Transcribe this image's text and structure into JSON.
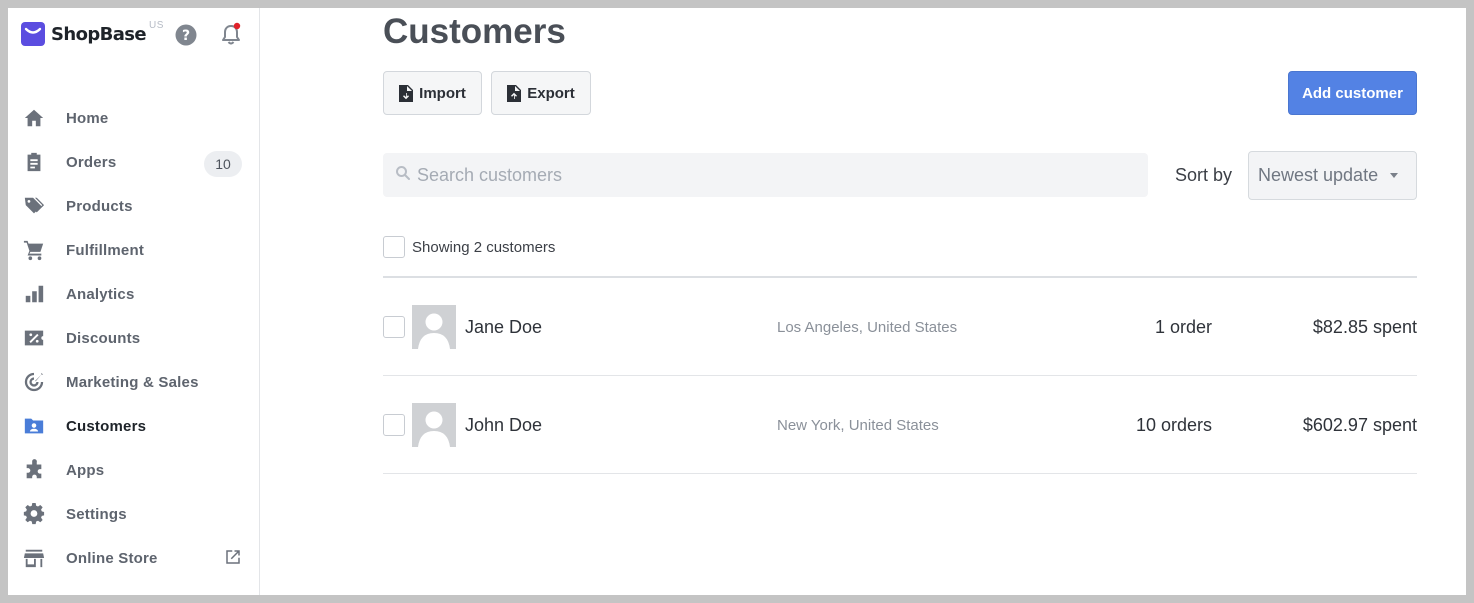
{
  "brand": {
    "name": "ShopBase",
    "region": "US",
    "color": "#5b4de0"
  },
  "header_icons": [
    "help-icon",
    "bell-icon"
  ],
  "sidebar": {
    "items": [
      {
        "label": "Home",
        "icon": "home-icon"
      },
      {
        "label": "Orders",
        "icon": "clipboard-icon",
        "badge": "10"
      },
      {
        "label": "Products",
        "icon": "tag-icon"
      },
      {
        "label": "Fulfillment",
        "icon": "cart-icon"
      },
      {
        "label": "Analytics",
        "icon": "bar-chart-icon"
      },
      {
        "label": "Discounts",
        "icon": "percent-icon"
      },
      {
        "label": "Marketing & Sales",
        "icon": "target-icon"
      },
      {
        "label": "Customers",
        "icon": "customer-folder-icon",
        "active": true
      },
      {
        "label": "Apps",
        "icon": "puzzle-icon"
      },
      {
        "label": "Settings",
        "icon": "gear-icon"
      },
      {
        "label": "Online Store",
        "icon": "store-icon",
        "external_icon": "external-link-icon"
      }
    ]
  },
  "main": {
    "title": "Customers",
    "import_label": "Import",
    "export_label": "Export",
    "add_label": "Add customer",
    "search_placeholder": "Search customers",
    "sort_label": "Sort by",
    "sort_value": "Newest update",
    "showing_text": "Showing 2 customers",
    "customers": [
      {
        "name": "Jane Doe",
        "location": "Los Angeles, United States",
        "orders": "1 order",
        "spent": "$82.85 spent"
      },
      {
        "name": "John Doe",
        "location": "New York, United States",
        "orders": "10 orders",
        "spent": "$602.97 spent"
      }
    ]
  },
  "colors": {
    "primary": "#5382e4",
    "active_icon": "#4a7dd8",
    "notification_dot": "#e0222a"
  }
}
